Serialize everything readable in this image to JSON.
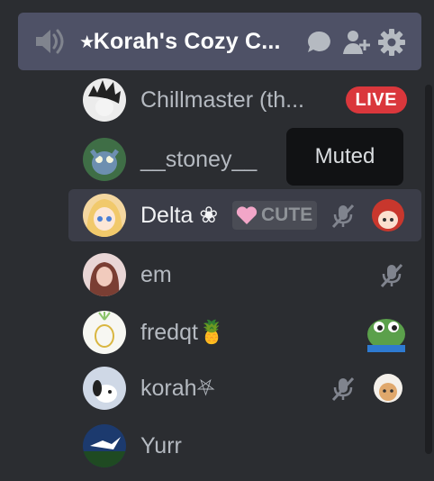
{
  "channel": {
    "name": "⭑Korah's Cozy C...",
    "icons": [
      "speaker-icon",
      "chat-bubble-icon",
      "invite-user-icon",
      "gear-icon"
    ]
  },
  "tooltip": {
    "text": "Muted"
  },
  "users": [
    {
      "name": "Chillmaster (th...",
      "badge": "LIVE",
      "avatar_color": "#e8e8e8"
    },
    {
      "name": "__stoney__",
      "avatar_color": "#3f6e46"
    },
    {
      "name": "Delta ❀",
      "tag": "CUTE",
      "muted": true,
      "selected": true,
      "avatar_color": "#f4d7a0"
    },
    {
      "name": "em",
      "muted": true,
      "avatar_color": "#c58f8a"
    },
    {
      "name": "fredqt🍍",
      "avatar_color": "#f2f2f2"
    },
    {
      "name": "korah⛧",
      "muted": true,
      "avatar_color": "#cfd8e6"
    },
    {
      "name": "Yurr",
      "avatar_color": "#1c3a6e"
    }
  ],
  "colors": {
    "background": "#2b2d31",
    "channel_bg": "#4e5166",
    "live_red": "#da373c",
    "muted_icon": "#80848e"
  }
}
